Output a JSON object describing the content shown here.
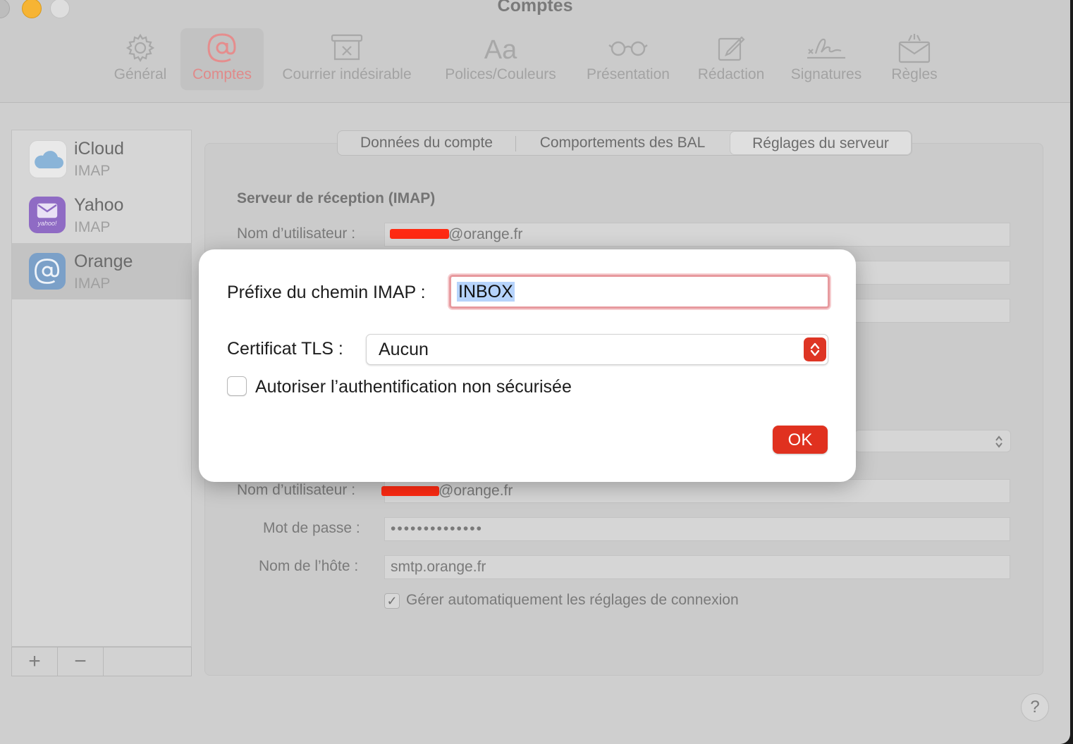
{
  "window": {
    "title": "Comptes"
  },
  "toolbar": [
    {
      "label": "Général",
      "icon": "gear-icon"
    },
    {
      "label": "Comptes",
      "icon": "at-icon",
      "active": true
    },
    {
      "label": "Courrier indésirable",
      "icon": "junk-tray-icon"
    },
    {
      "label": "Polices/Couleurs",
      "icon": "font-aa-icon",
      "glyph": "Aa"
    },
    {
      "label": "Présentation",
      "icon": "glasses-icon"
    },
    {
      "label": "Rédaction",
      "icon": "compose-icon"
    },
    {
      "label": "Signatures",
      "icon": "signature-icon"
    },
    {
      "label": "Règles",
      "icon": "rules-envelope-icon"
    }
  ],
  "accounts": [
    {
      "name": "iCloud",
      "type": "IMAP",
      "icon": "icloud-icon"
    },
    {
      "name": "Yahoo",
      "type": "IMAP",
      "icon": "yahoo-icon",
      "icon_text": "yahoo!"
    },
    {
      "name": "Orange",
      "type": "IMAP",
      "icon": "at-icon",
      "selected": true
    }
  ],
  "sidebar_footer": {
    "add": "+",
    "remove": "−"
  },
  "tabs": [
    {
      "label": "Données du compte"
    },
    {
      "label": "Comportements des BAL"
    },
    {
      "label": "Réglages du serveur",
      "active": true
    }
  ],
  "incoming": {
    "heading": "Serveur de réception (IMAP)",
    "username_label": "Nom d’utilisateur :",
    "username_value": "@orange.fr"
  },
  "outgoing": {
    "username_label": "Nom d’utilisateur :",
    "username_value": "@orange.fr",
    "password_label": "Mot de passe :",
    "password_value": "••••••••••••••",
    "host_label": "Nom de l’hôte :",
    "host_value": "smtp.orange.fr",
    "auto_manage_label": "Gérer automatiquement les réglages de connexion",
    "auto_manage_checked": true
  },
  "sheet": {
    "prefix_label": "Préfixe du chemin IMAP :",
    "prefix_value": "INBOX",
    "tls_label": "Certificat TLS :",
    "tls_value": "Aucun",
    "insecure_auth_label": "Autoriser l’authentification non sécurisée",
    "insecure_auth_checked": false,
    "ok_label": "OK"
  },
  "help": {
    "label": "?"
  },
  "colors": {
    "accent": "#e0311f",
    "selection": "#b6d3fb",
    "focus_ring": "#e79a9e"
  }
}
